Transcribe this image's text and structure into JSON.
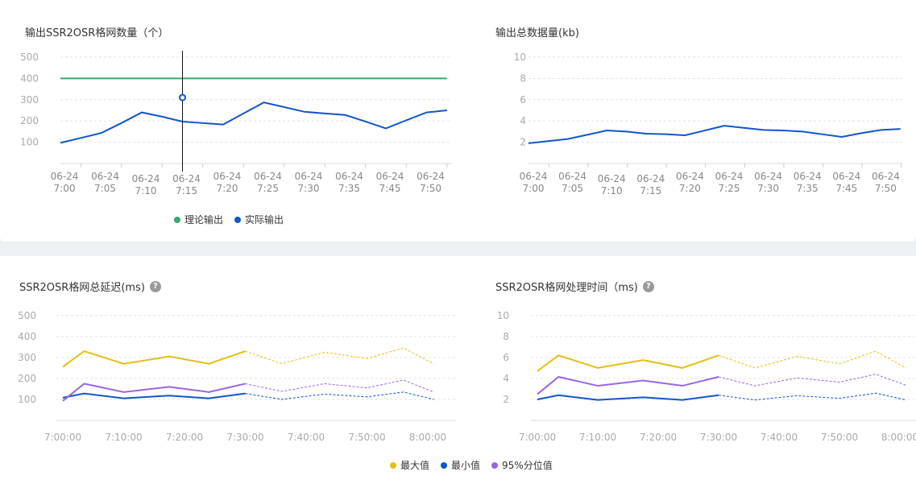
{
  "chart_data": [
    {
      "type": "line",
      "title": "输出SSR2OSR格网数量（个）",
      "categories": [
        [
          "06-24",
          "7:00"
        ],
        [
          "06-24",
          "7:05"
        ],
        [
          "06-24",
          "7:10"
        ],
        [
          "06-24",
          "7:15"
        ],
        [
          "06-24",
          "7:20"
        ],
        [
          "06-24",
          "7:25"
        ],
        [
          "06-24",
          "7:30"
        ],
        [
          "06-24",
          "7:35"
        ],
        [
          "06-24",
          "7:45"
        ],
        [
          "06-24",
          "7:50"
        ]
      ],
      "x": [
        0,
        0.5,
        1,
        1.5,
        2,
        2.5,
        3,
        3.5,
        4,
        4.5,
        5,
        5.5,
        6,
        6.5,
        7,
        7.5,
        8,
        8.5,
        9,
        9.5
      ],
      "yticks": [
        100,
        200,
        300,
        400,
        500
      ],
      "ylim": [
        0,
        530
      ],
      "grid": true,
      "legend_position": "bottom-center",
      "series": [
        {
          "name": "理论输出",
          "color": "#3aa86e",
          "values": [
            400,
            400,
            400,
            400,
            400,
            400,
            400,
            400,
            400,
            400,
            400,
            400,
            400,
            400,
            400,
            400,
            400,
            400,
            400,
            400
          ]
        },
        {
          "name": "实际输出",
          "color": "#1056c9",
          "values": [
            97,
            120,
            143,
            190,
            240,
            220,
            197,
            190,
            183,
            235,
            287,
            265,
            243,
            235,
            228,
            197,
            165,
            203,
            240,
            250
          ]
        }
      ],
      "hover": {
        "x": 3,
        "value": 310
      }
    },
    {
      "type": "line",
      "title": "输出总数据量(kb)",
      "categories": [
        [
          "06-24",
          "7:00"
        ],
        [
          "06-24",
          "7:05"
        ],
        [
          "06-24",
          "7:10"
        ],
        [
          "06-24",
          "7:15"
        ],
        [
          "06-24",
          "7:20"
        ],
        [
          "06-24",
          "7:25"
        ],
        [
          "06-24",
          "7:30"
        ],
        [
          "06-24",
          "7:35"
        ],
        [
          "06-24",
          "7:45"
        ],
        [
          "06-24",
          "7:50"
        ]
      ],
      "x": [
        0,
        0.5,
        1,
        1.5,
        2,
        2.5,
        3,
        3.5,
        4,
        4.5,
        5,
        5.5,
        6,
        6.5,
        7,
        7.5,
        8,
        8.5,
        9,
        9.5
      ],
      "yticks": [
        2,
        4,
        6,
        8,
        10
      ],
      "ylim": [
        0,
        10.6
      ],
      "grid": true,
      "series": [
        {
          "name": "",
          "color": "#1056c9",
          "values": [
            1.9,
            2.1,
            2.3,
            2.7,
            3.1,
            3.0,
            2.8,
            2.75,
            2.65,
            3.1,
            3.55,
            3.35,
            3.15,
            3.1,
            3.0,
            2.75,
            2.5,
            2.85,
            3.15,
            3.25
          ]
        }
      ]
    },
    {
      "type": "line",
      "title": "SSR2OSR格网总延迟(ms)",
      "xticks": [
        "7:00:00",
        "7:10:00",
        "7:20:00",
        "7:30:00",
        "7:40:00",
        "7:50:00",
        "8:00:00"
      ],
      "xlim": [
        0,
        60
      ],
      "yticks": [
        100,
        200,
        300,
        400,
        500
      ],
      "ylim": [
        0,
        530
      ],
      "grid": true,
      "legend_position": "bottom-center",
      "solid_until": 30,
      "x": [
        0,
        3.5,
        10,
        17.5,
        24,
        30,
        36,
        43,
        50,
        56,
        61
      ],
      "series": [
        {
          "name": "最大值",
          "color": "#e6bf10",
          "values": [
            255,
            330,
            270,
            305,
            270,
            330,
            270,
            325,
            295,
            345,
            270
          ]
        },
        {
          "name": "最小值",
          "color": "#1056c9",
          "values": [
            108,
            128,
            105,
            118,
            105,
            128,
            100,
            125,
            112,
            135,
            100
          ]
        },
        {
          "name": "95%分位值",
          "color": "#9965e6",
          "values": [
            93,
            175,
            135,
            160,
            135,
            175,
            138,
            175,
            155,
            192,
            135
          ]
        }
      ]
    },
    {
      "type": "line",
      "title": "SSR2OSR格网处理时间（ms)",
      "xticks": [
        "7:00:00",
        "7:10:00",
        "7:20:00",
        "7:30:00",
        "7:40:00",
        "7:50:00",
        "8:00:00"
      ],
      "xlim": [
        0,
        60
      ],
      "yticks": [
        2,
        4,
        6,
        8,
        10
      ],
      "ylim": [
        0,
        10.6
      ],
      "grid": true,
      "solid_until": 30,
      "x": [
        0,
        3.5,
        10,
        17.5,
        24,
        30,
        36,
        43,
        50,
        56,
        61
      ],
      "series": [
        {
          "name": "最大值",
          "color": "#e6bf10",
          "values": [
            4.7,
            6.2,
            5.0,
            5.75,
            5.0,
            6.2,
            5.0,
            6.1,
            5.4,
            6.6,
            5.0
          ]
        },
        {
          "name": "最小值",
          "color": "#1056c9",
          "values": [
            2.0,
            2.4,
            1.95,
            2.2,
            1.95,
            2.4,
            1.95,
            2.35,
            2.1,
            2.6,
            1.95
          ]
        },
        {
          "name": "95%分位值",
          "color": "#9965e6",
          "values": [
            2.5,
            4.15,
            3.3,
            3.8,
            3.3,
            4.15,
            3.3,
            4.05,
            3.65,
            4.4,
            3.35
          ]
        }
      ]
    }
  ],
  "legends": {
    "top": [
      {
        "label": "理论输出",
        "color": "#3aa86e"
      },
      {
        "label": "实际输出",
        "color": "#1056c9"
      }
    ],
    "bottom": [
      {
        "label": "最大值",
        "color": "#e6bf10"
      },
      {
        "label": "最小值",
        "color": "#1056c9"
      },
      {
        "label": "95%分位值",
        "color": "#9965e6"
      }
    ]
  },
  "help_icon_glyph": "?"
}
